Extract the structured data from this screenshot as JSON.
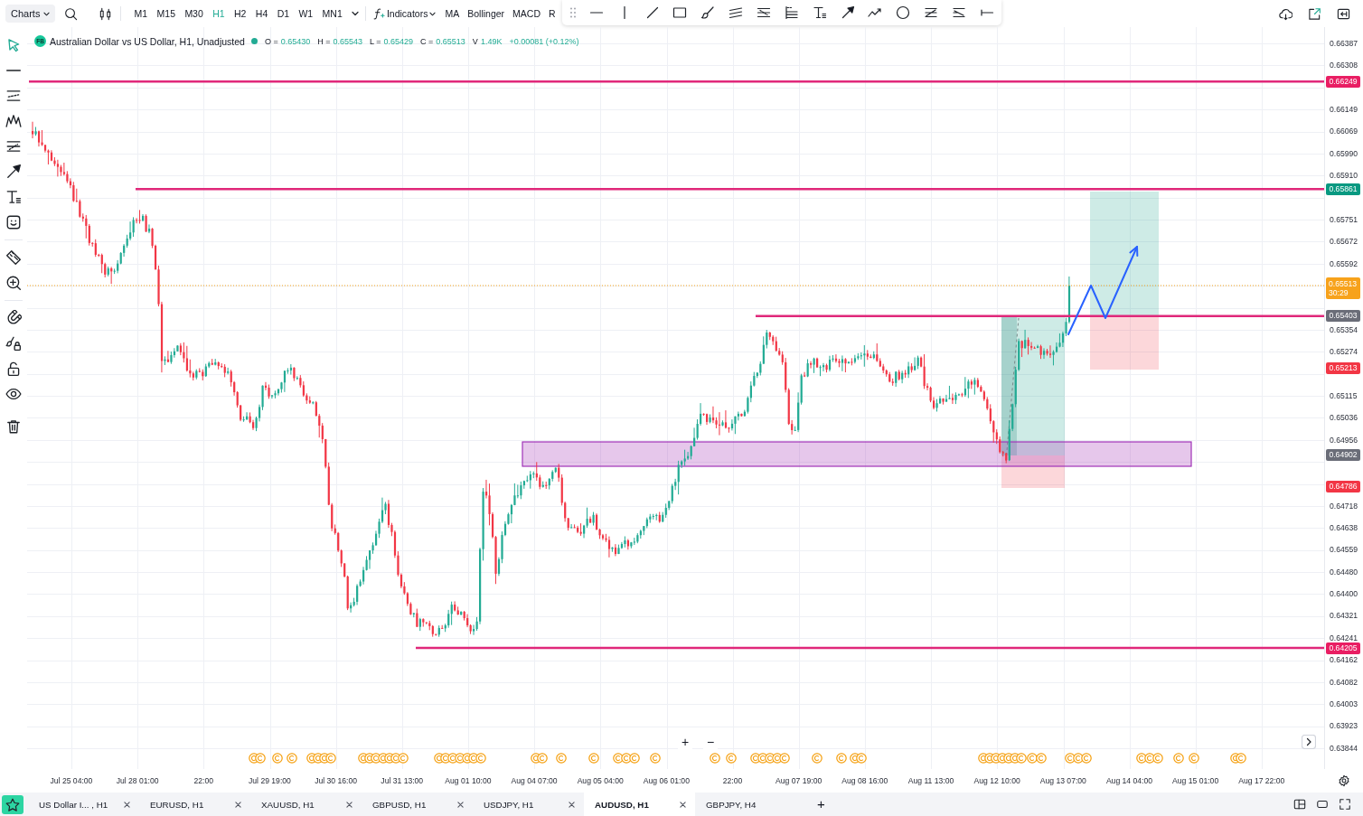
{
  "top_bar": {
    "chart_menu": "Charts",
    "timeframes": [
      {
        "label": "M1",
        "selected": false
      },
      {
        "label": "M15",
        "selected": false
      },
      {
        "label": "M30",
        "selected": false
      },
      {
        "label": "H1",
        "selected": true
      },
      {
        "label": "H2",
        "selected": false
      },
      {
        "label": "H4",
        "selected": false
      },
      {
        "label": "D1",
        "selected": false
      },
      {
        "label": "W1",
        "selected": false
      },
      {
        "label": "MN1",
        "selected": false
      }
    ],
    "indicators_menu": "Indicators",
    "quick_indicators": [
      "MA",
      "Bollinger",
      "MACD",
      "R"
    ]
  },
  "left_toolbar": {
    "groups": [
      {
        "tools": [
          {
            "kind": "cursor",
            "selected": true
          },
          {
            "kind": "line",
            "selected": false
          },
          {
            "kind": "channel",
            "selected": false
          },
          {
            "kind": "pattern",
            "selected": false
          },
          {
            "kind": "fibonacci",
            "selected": false
          },
          {
            "kind": "arrow",
            "selected": false
          },
          {
            "kind": "text",
            "selected": false
          },
          {
            "kind": "sticker",
            "selected": false
          }
        ]
      },
      {
        "tools": [
          {
            "kind": "ruler",
            "selected": false
          },
          {
            "kind": "zoom",
            "selected": false
          }
        ]
      },
      {
        "tools": [
          {
            "kind": "magnet",
            "selected": false
          },
          {
            "kind": "brushlock",
            "selected": false
          },
          {
            "kind": "lock",
            "selected": false
          },
          {
            "kind": "eye",
            "selected": false
          }
        ]
      },
      {
        "tools": [
          {
            "kind": "trash",
            "selected": false
          }
        ]
      }
    ]
  },
  "legend": {
    "logo": "FB",
    "title": "Australian Dollar vs US Dollar, H1, Unadjusted",
    "ohlc": [
      {
        "label": "O =",
        "value": "0.65430"
      },
      {
        "label": "H =",
        "value": "0.65543"
      },
      {
        "label": "L =",
        "value": "0.65429"
      },
      {
        "label": "C =",
        "value": "0.65513"
      },
      {
        "label": "V",
        "value": "1.49K"
      }
    ],
    "change": "+0.00081 (+0.12%)"
  },
  "chart": {
    "zoom_in": "+",
    "zoom_out": "−"
  },
  "price_axis": {
    "ticks": [
      "0.66387",
      "0.66308",
      "0.66149",
      "0.66069",
      "0.65990",
      "0.65910",
      "0.65751",
      "0.65672",
      "0.65592",
      "0.65354",
      "0.65274",
      "0.65115",
      "0.65036",
      "0.64956",
      "0.64718",
      "0.64638",
      "0.64559",
      "0.64480",
      "0.64400",
      "0.64321",
      "0.64241",
      "0.64162",
      "0.64082",
      "0.64003",
      "0.63923",
      "0.63844"
    ],
    "tags": [
      {
        "text": "0.66249",
        "color": "#e91e63"
      },
      {
        "text": "0.65861",
        "color": "#089981"
      },
      {
        "text": "0.65513",
        "countdown": "30:29",
        "color": "#f7a21b"
      },
      {
        "text": "0.65403",
        "color": "#6a6d78"
      },
      {
        "text": "0.65213",
        "color": "#f23645"
      },
      {
        "text": "0.64902",
        "color": "#6a6d78"
      },
      {
        "text": "0.64786",
        "color": "#f23645"
      },
      {
        "text": "0.64205",
        "color": "#e91e63"
      }
    ]
  },
  "time_axis": {
    "labels": [
      "Jul 25 04:00",
      "Jul 28 01:00",
      "22:00",
      "Jul 29 19:00",
      "Jul 30 16:00",
      "Jul 31 13:00",
      "Aug 01 10:00",
      "Aug 04 07:00",
      "Aug 05 04:00",
      "Aug 06 01:00",
      "22:00",
      "Aug 07 19:00",
      "Aug 08 16:00",
      "Aug 11 13:00",
      "Aug 12 10:00",
      "Aug 13 07:00",
      "Aug 14 04:00",
      "Aug 15 01:00",
      "Aug 17 22:00"
    ]
  },
  "tabs": [
    {
      "label": "US Dollar I... , H1",
      "selected": false,
      "closable": true
    },
    {
      "label": "EURUSD, H1",
      "selected": false,
      "closable": true
    },
    {
      "label": "XAUUSD, H1",
      "selected": false,
      "closable": true
    },
    {
      "label": "GBPUSD, H1",
      "selected": false,
      "closable": true
    },
    {
      "label": "USDJPY, H1",
      "selected": false,
      "closable": true
    },
    {
      "label": "AUDUSD, H1",
      "selected": true,
      "closable": true
    },
    {
      "label": "GBPJPY, H4",
      "selected": false,
      "closable": false
    }
  ],
  "add_tab": "+"
}
